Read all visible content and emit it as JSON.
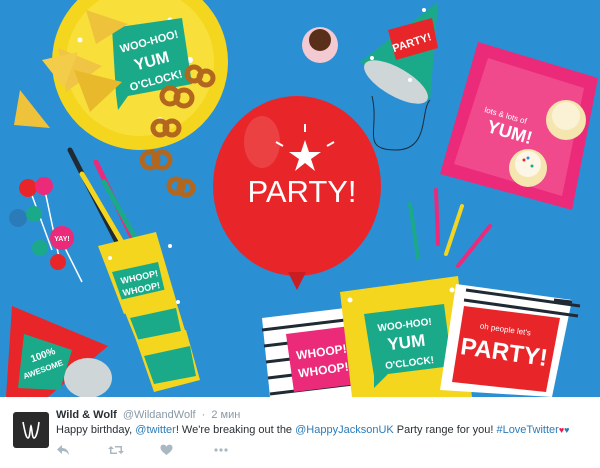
{
  "media": {
    "balloon_text": "PARTY!",
    "plate_text": [
      "WOO-HOO!",
      "YUM",
      "O'CLOCK!"
    ],
    "hat_text": "PARTY!",
    "square_plate_text": [
      "lots & lots of",
      "YUM!"
    ],
    "hat2_text": [
      "100%",
      "AWESOME"
    ],
    "cup_text": [
      "WHOOP!",
      "WHOOP!"
    ],
    "pick_text": "YAY!",
    "napkin_left_text": [
      "WHOOP!",
      "WHOOP!"
    ],
    "napkin_center_text": [
      "WOO-HOO!",
      "YUM",
      "O'CLOCK!"
    ],
    "napkin_right_text": [
      "oh people let's",
      "PARTY!"
    ]
  },
  "tweet": {
    "author_name": "Wild & Wolf",
    "author_handle": "@WildandWolf",
    "separator": "·",
    "time": "2 мин",
    "text_before": "Happy birthday, ",
    "mention1": "@twitter",
    "text_mid": "!  We're breaking out the ",
    "mention2": "@HappyJacksonUK",
    "text_after": " Party range for you!  ",
    "hashtag": "#LoveTwitter",
    "hearts": [
      "♥",
      "♥"
    ]
  },
  "actions": [
    {
      "name": "reply-icon"
    },
    {
      "name": "retweet-icon"
    },
    {
      "name": "like-icon"
    },
    {
      "name": "more-icon"
    }
  ],
  "colors": {
    "background_blue": "#2b8fd4",
    "balloon_red": "#e8262a",
    "plate_yellow": "#f5d61e",
    "plate_pink": "#ec2a7a",
    "link_blue": "#2b7bb9",
    "heart_red": "#e81c4f"
  }
}
